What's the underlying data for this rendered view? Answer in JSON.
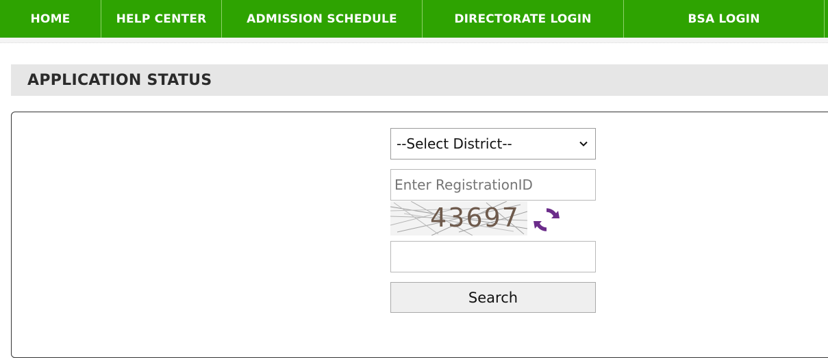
{
  "nav": {
    "items": [
      {
        "label": "HOME"
      },
      {
        "label": "HELP CENTER"
      },
      {
        "label": "ADMISSION SCHEDULE"
      },
      {
        "label": "DIRECTORATE LOGIN"
      },
      {
        "label": "BSA LOGIN"
      }
    ],
    "background_color": "#2ea301"
  },
  "section": {
    "title": "APPLICATION STATUS"
  },
  "form": {
    "district_select": {
      "selected": "--Select District--"
    },
    "registration_input": {
      "value": "",
      "placeholder": "Enter RegistrationID"
    },
    "captcha": {
      "text": "43697",
      "refresh_icon": "refresh-icon",
      "refresh_icon_color": "#6b2c8a"
    },
    "captcha_input": {
      "value": ""
    },
    "search_button": {
      "label": "Search"
    }
  }
}
